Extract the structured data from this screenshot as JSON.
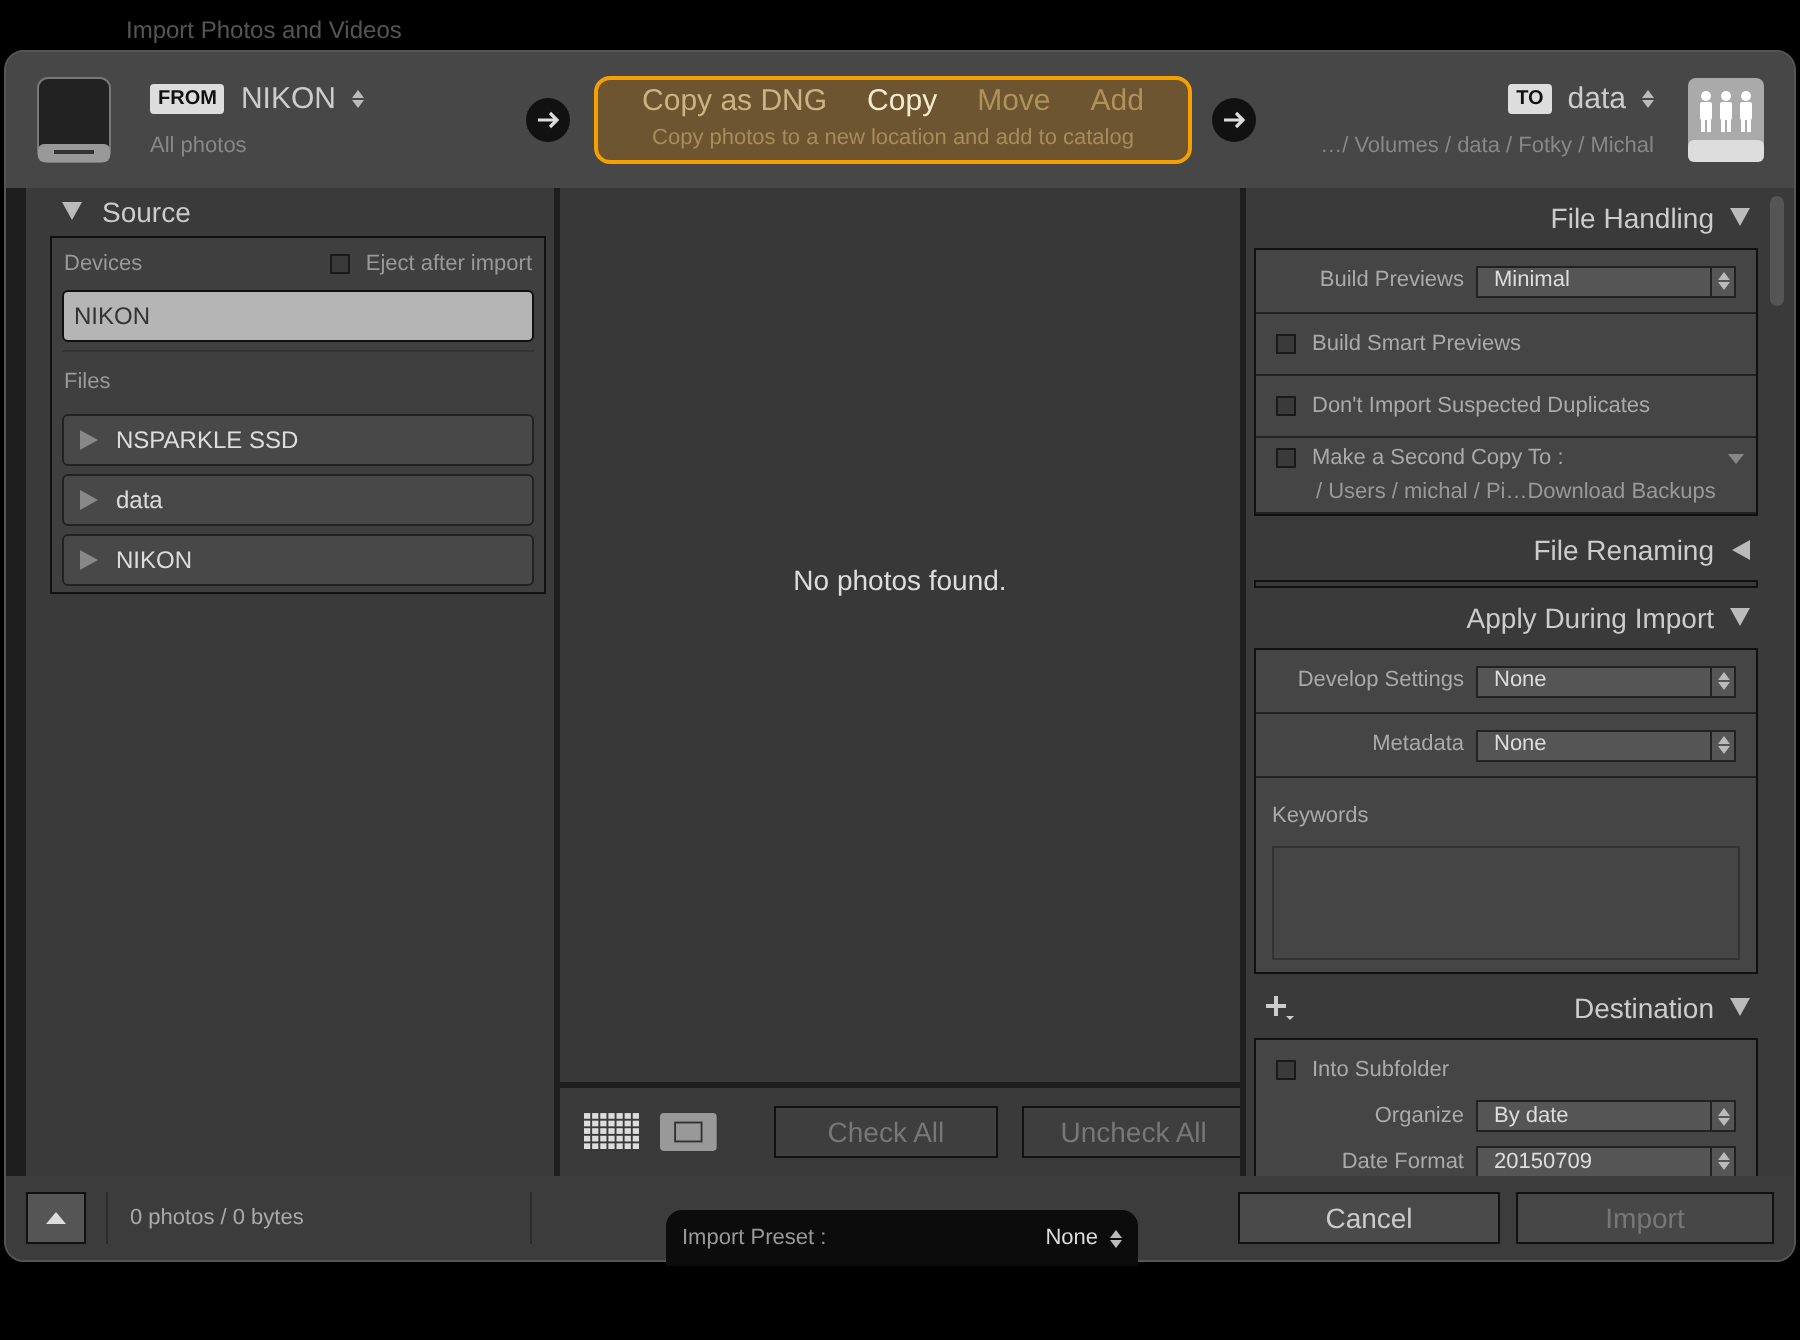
{
  "background_title": "Import Photos and Videos",
  "from": {
    "label": "FROM",
    "source": "NIKON",
    "subtitle": "All photos"
  },
  "modes": [
    {
      "label": "Copy as DNG",
      "selected": false,
      "disabled": false
    },
    {
      "label": "Copy",
      "selected": true,
      "disabled": false
    },
    {
      "label": "Move",
      "selected": false,
      "disabled": true
    },
    {
      "label": "Add",
      "selected": false,
      "disabled": true
    }
  ],
  "mode_description": "Copy photos to a new location and add to catalog",
  "to": {
    "label": "TO",
    "destination": "data",
    "path": "…/ Volumes / data / Fotky / Michal"
  },
  "source": {
    "title": "Source",
    "expanded": true,
    "devices_label": "Devices",
    "eject": {
      "label": "Eject after import",
      "checked": false
    },
    "devices": [
      {
        "name": "NIKON",
        "selected": true
      }
    ],
    "files_label": "Files",
    "files": [
      {
        "name": "NSPARKLE SSD",
        "expanded": false
      },
      {
        "name": "data",
        "expanded": false
      },
      {
        "name": "NIKON",
        "expanded": false
      }
    ]
  },
  "center": {
    "message": "No photos found.",
    "views": [
      {
        "kind": "grid",
        "selected": true
      },
      {
        "kind": "loupe",
        "selected": false
      }
    ],
    "check_all": "Check All",
    "uncheck_all": "Uncheck All"
  },
  "sections": [
    {
      "title": "File Handling",
      "expanded": true,
      "add": false,
      "rows": [
        {
          "kind": "select",
          "label": "Build Previews",
          "value": "Minimal"
        },
        {
          "kind": "checkbox",
          "label": "Build Smart Previews",
          "checked": false
        },
        {
          "kind": "checkbox",
          "label": "Don't Import Suspected Duplicates",
          "checked": false
        },
        {
          "kind": "checkbox_path",
          "label": "Make a Second Copy To :",
          "checked": false,
          "path": "/ Users / michal / Pi…Download Backups"
        }
      ]
    },
    {
      "title": "File Renaming",
      "expanded": false,
      "add": false
    },
    {
      "title": "Apply During Import",
      "expanded": true,
      "add": false,
      "rows": [
        {
          "kind": "select",
          "label": "Develop Settings",
          "value": "None"
        },
        {
          "kind": "select",
          "label": "Metadata",
          "value": "None"
        },
        {
          "kind": "textarea",
          "label": "Keywords"
        }
      ]
    },
    {
      "title": "Destination",
      "expanded": true,
      "add": true,
      "rows": [
        {
          "kind": "destination",
          "label": "Into Subfolder",
          "checked": false,
          "selects": [
            {
              "label": "Organize",
              "value": "By date"
            },
            {
              "label": "Date Format",
              "value": "20150709"
            }
          ]
        }
      ]
    }
  ],
  "footer": {
    "summary": "0 photos / 0 bytes",
    "preset": {
      "label": "Import Preset :",
      "value": "None"
    },
    "cancel": "Cancel",
    "import": {
      "label": "Import",
      "disabled": true
    }
  }
}
